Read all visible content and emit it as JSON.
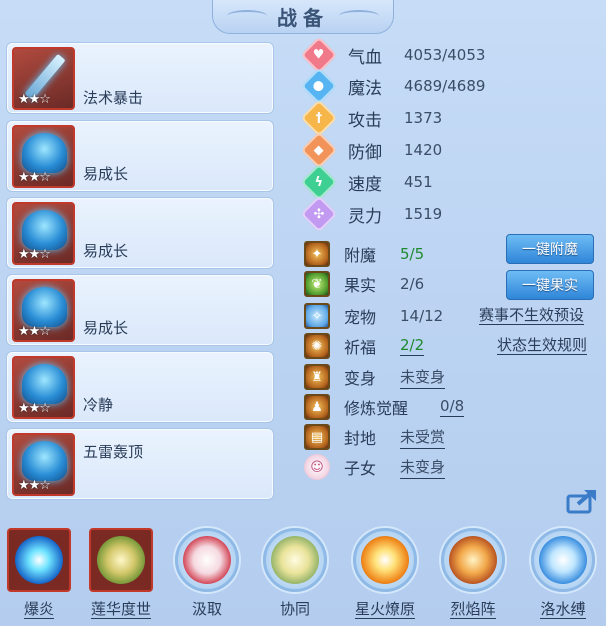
{
  "title": "战备",
  "slots": [
    {
      "label": "法术暴击",
      "stars": "★★☆",
      "icon": "sword-icon"
    },
    {
      "label": "易成长",
      "stars": "★★☆",
      "icon": "blue-beast-icon"
    },
    {
      "label": "易成长",
      "stars": "★★☆",
      "icon": "blue-beast-icon"
    },
    {
      "label": "易成长",
      "stars": "★★☆",
      "icon": "blue-beast-icon"
    },
    {
      "label": "冷静",
      "stars": "★★☆",
      "icon": "blue-beast-icon"
    },
    {
      "label": "五雷轰顶",
      "stars": "★★☆",
      "icon": "blue-beast-icon"
    }
  ],
  "stats": [
    {
      "label": "气血",
      "value": "4053/4053",
      "icon": "heart-icon",
      "color": "#f07a8a"
    },
    {
      "label": "魔法",
      "value": "4689/4689",
      "icon": "mana-drop-icon",
      "color": "#56b4f2"
    },
    {
      "label": "攻击",
      "value": "1373",
      "icon": "sword-up-icon",
      "color": "#f6b64a"
    },
    {
      "label": "防御",
      "value": "1420",
      "icon": "shield-icon",
      "color": "#f2935a"
    },
    {
      "label": "速度",
      "value": "451",
      "icon": "lightning-icon",
      "color": "#3ecf93"
    },
    {
      "label": "灵力",
      "value": "1519",
      "icon": "spirit-icon",
      "color": "#c39af2"
    }
  ],
  "attrs": [
    {
      "label": "附魔",
      "value": "5/5",
      "icon": "enchant-icon",
      "style": "green"
    },
    {
      "label": "果实",
      "value": "2/6",
      "icon": "fruit-icon",
      "style": ""
    },
    {
      "label": "宠物",
      "value": "14/12",
      "icon": "pet-icon",
      "style": ""
    },
    {
      "label": "祈福",
      "value": "2/2",
      "icon": "bless-icon",
      "style": "green"
    },
    {
      "label": "变身",
      "value": "未变身",
      "icon": "transform-icon",
      "style": "underline"
    },
    {
      "label": "修炼觉醒",
      "value": "0/8",
      "icon": "cultivation-icon",
      "style": "underline"
    },
    {
      "label": "封地",
      "value": "未受赏",
      "icon": "fief-icon",
      "style": "underline"
    },
    {
      "label": "子女",
      "value": "未变身",
      "icon": "child-icon",
      "style": "underline"
    }
  ],
  "buttons": {
    "enchant": "一键附魔",
    "fruit": "一键果实"
  },
  "links": {
    "preset": "赛事不生效预设",
    "rules": "状态生效规则"
  },
  "skills": [
    {
      "label": "爆炎",
      "underline": true
    },
    {
      "label": "莲华度世",
      "underline": true
    },
    {
      "label": "汲取",
      "underline": false
    },
    {
      "label": "协同",
      "underline": false
    },
    {
      "label": "星火燎原",
      "underline": true
    },
    {
      "label": "烈焰阵",
      "underline": true
    },
    {
      "label": "洛水缚",
      "underline": true
    }
  ]
}
